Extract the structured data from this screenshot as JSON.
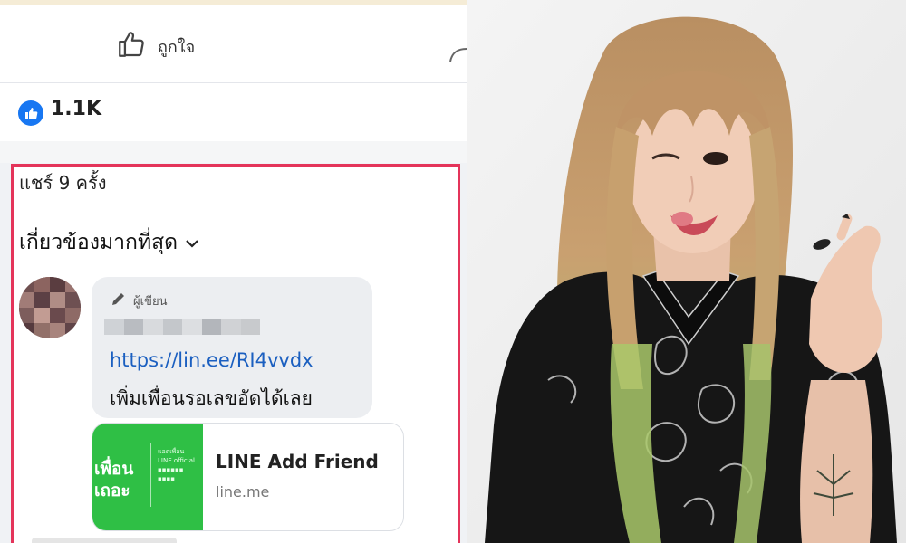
{
  "post_actions": {
    "like_label": "ถูกใจ",
    "like_icon": "thumbs-up-icon",
    "share_icon": "share-arrow-icon"
  },
  "reactions": {
    "count": "1.1K",
    "icon": "like-reaction-icon",
    "color": "#1877f2"
  },
  "comments_section": {
    "shares_label": "แชร์ 9 ครั้ง",
    "sort_label": "เกี่ยวข้องมากที่สุด",
    "highlight_color": "#e4345a",
    "comment": {
      "author_badge": "ผู้เขียน",
      "link": "https://lin.ee/RI4vvdx",
      "message": "เพิ่มเพื่อนรอเลขอัดได้เลย"
    },
    "link_preview": {
      "thumb_text": "เพื่อน\nเถอะ",
      "title": "LINE Add Friend",
      "domain": "line.me",
      "thumb_color": "#2fbf45"
    }
  },
  "photo": {
    "subject": "woman with long blonde and green-tipped hair in a black paisley shirt making a finger-heart gesture"
  }
}
